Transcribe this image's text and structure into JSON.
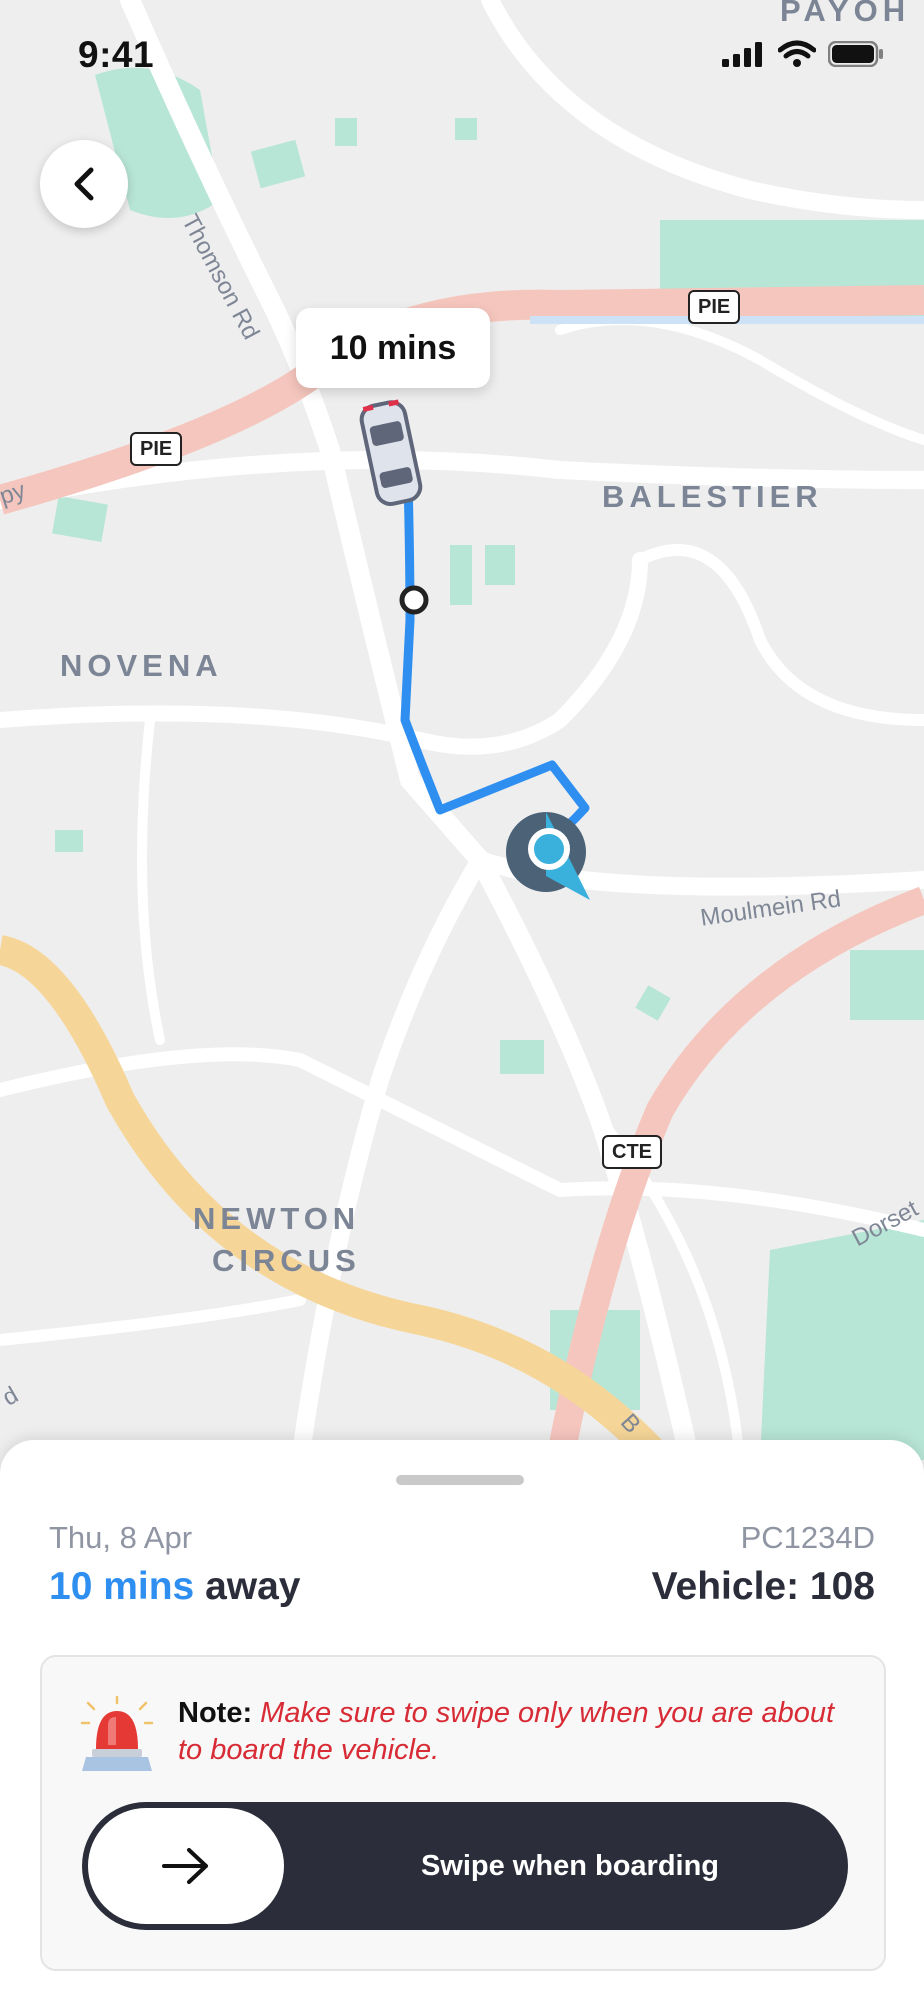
{
  "status_bar": {
    "time": "9:41"
  },
  "map": {
    "eta_bubble": "10 mins",
    "area_labels": [
      "BALESTIER",
      "NOVENA",
      "NEWTON",
      "CIRCUS",
      "PAYOH"
    ],
    "road_labels": [
      "Thomson Rd",
      "Moulmein Rd",
      "Dorset",
      "py",
      "d",
      "B"
    ],
    "shields": [
      "PIE",
      "PIE",
      "CTE"
    ]
  },
  "trip": {
    "date": "Thu, 8 Apr",
    "eta_value": "10 mins",
    "eta_suffix": " away",
    "plate": "PC1234D",
    "vehicle": "Vehicle: 108"
  },
  "note": {
    "label": "Note:",
    "body": " Make sure to swipe only when you are about to board the vehicle."
  },
  "swipe": {
    "label": "Swipe when boarding"
  },
  "colors": {
    "accent": "#2f8ff0",
    "dark": "#2b2e3a",
    "warning": "#d72b35",
    "route": "#2f8ff0"
  }
}
